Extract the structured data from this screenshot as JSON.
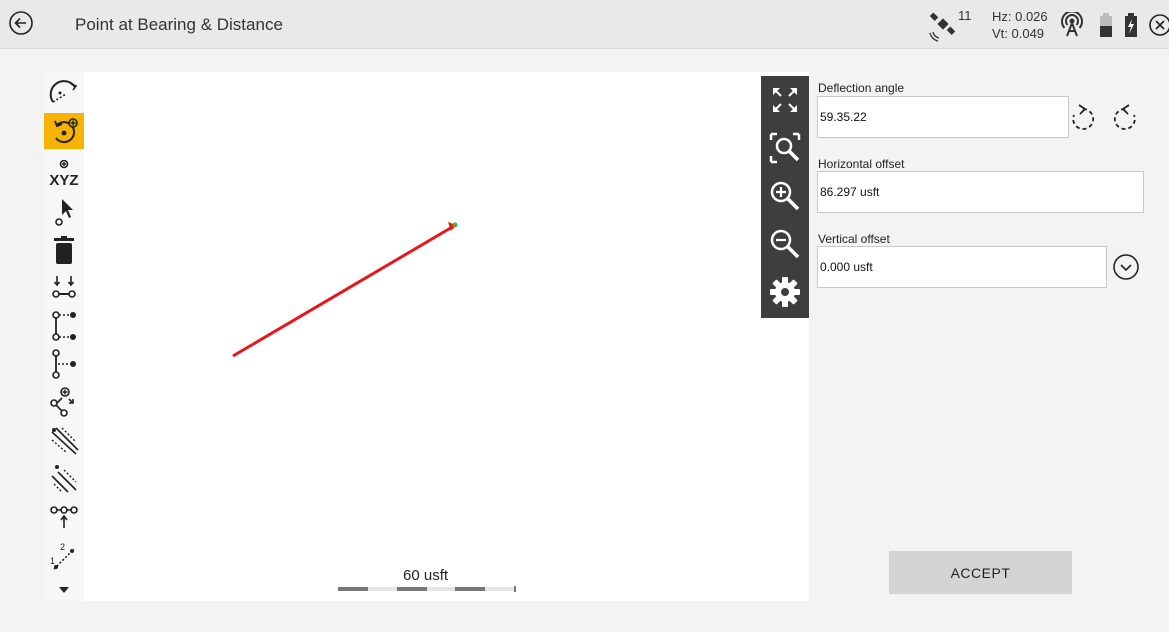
{
  "header": {
    "title": "Point at Bearing & Distance",
    "satellites": "11",
    "hz_precision": "Hz: 0.026",
    "vt_precision": "Vt: 0.049"
  },
  "toolbar": {
    "tools": [
      {
        "icon": "arc-tool-icon",
        "active": false
      },
      {
        "icon": "add-point-rotate-icon",
        "active": true
      },
      {
        "icon": "add-xyz-icon",
        "label": "XYZ",
        "active": false
      },
      {
        "icon": "select-point-icon",
        "active": false
      },
      {
        "icon": "delete-icon",
        "active": false
      },
      {
        "icon": "join-points-icon",
        "active": false
      },
      {
        "icon": "line-offset-icon",
        "active": false
      },
      {
        "icon": "point-on-line-icon",
        "active": false
      },
      {
        "icon": "add-node-icon",
        "active": false
      },
      {
        "icon": "hatch-line-icon",
        "active": false
      },
      {
        "icon": "hatch-line-alt-icon",
        "active": false
      },
      {
        "icon": "chain-points-icon",
        "active": false
      },
      {
        "icon": "numbered-points-icon",
        "active": false
      }
    ]
  },
  "map": {
    "scale_label": "60 usft",
    "line_color": "#e8161b"
  },
  "map_tools": [
    "zoom-extents-icon",
    "zoom-window-icon",
    "zoom-in-icon",
    "zoom-out-icon",
    "map-settings-icon"
  ],
  "form": {
    "deflection_label": "Deflection angle",
    "deflection_value": "59.35.22",
    "horizontal_label": "Horizontal offset",
    "horizontal_value": "86.297 usft",
    "vertical_label": "Vertical offset",
    "vertical_value": "0.000 usft",
    "accept_label": "ACCEPT"
  },
  "colors": {
    "active_tool": "#f6b400",
    "map_toolbar": "#3e3e3e",
    "accept_button": "#d4d4d4"
  }
}
